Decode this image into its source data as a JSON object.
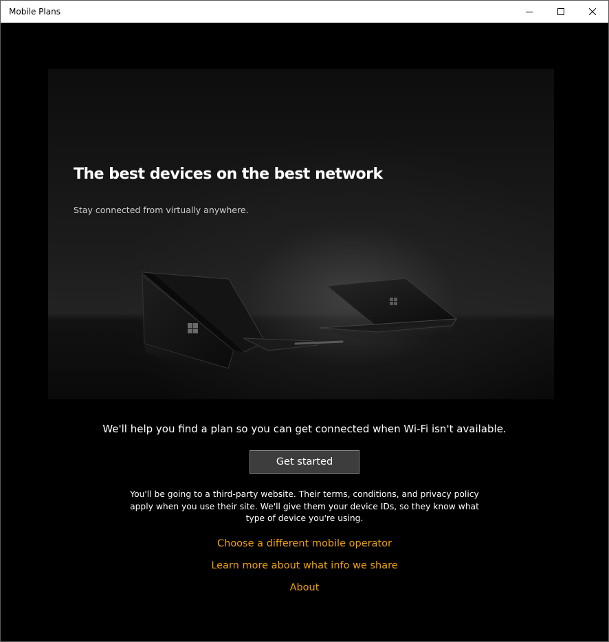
{
  "window": {
    "title": "Mobile Plans",
    "controls": {
      "minimize": "minimize-icon",
      "maximize": "maximize-icon",
      "close": "close-icon"
    }
  },
  "hero": {
    "title": "The best devices on the best network",
    "subtitle": "Stay connected from virtually anywhere."
  },
  "main": {
    "tagline": "We'll help you find a plan so you can get connected when Wi-Fi isn't available.",
    "get_started_label": "Get started",
    "disclaimer": "You'll be going to a third-party website. Their terms, conditions, and privacy policy apply when you use their site. We'll give them your device IDs, so they know what type of device you're using.",
    "links": {
      "choose_operator": "Choose a different mobile operator",
      "learn_more": "Learn more about what info we share",
      "about": "About"
    }
  },
  "colors": {
    "background": "#000000",
    "link": "#f0a30a",
    "button_bg": "#3d3d3d",
    "button_border": "#8a8a8a",
    "titlebar": "#ffffff"
  }
}
